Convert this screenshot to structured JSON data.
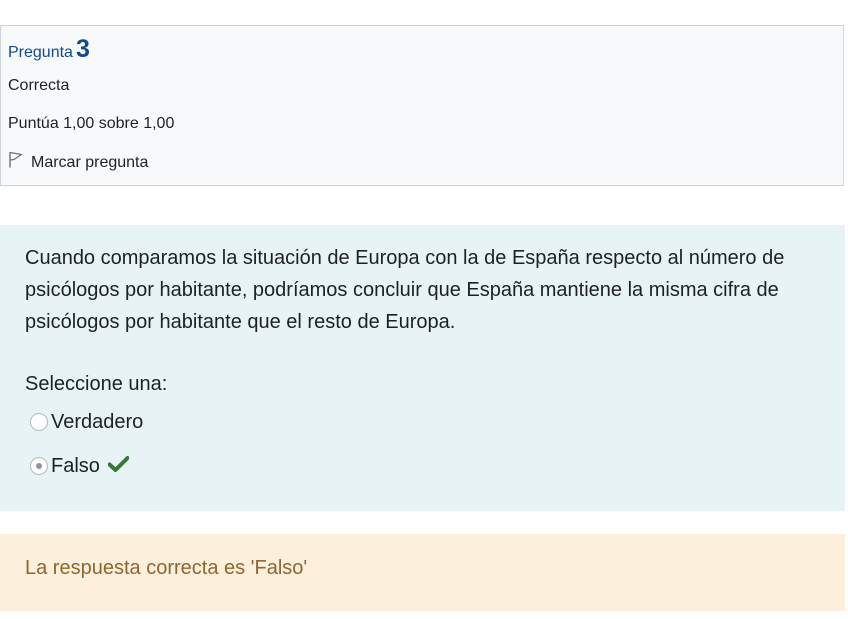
{
  "info": {
    "question_label": "Pregunta",
    "question_number": "3",
    "state": "Correcta",
    "grade": "Puntúa 1,00 sobre 1,00",
    "flag_label": "Marcar pregunta",
    "flag_icon": "flag-icon"
  },
  "question": {
    "text": "Cuando comparamos la situación de Europa con la de España respecto al número de psicólogos por habitante, podríamos concluir que España mantiene la misma cifra de psicólogos por habitante que el resto de Europa.",
    "prompt": "Seleccione una:",
    "options": [
      {
        "label": "Verdadero",
        "selected": false
      },
      {
        "label": "Falso",
        "selected": true,
        "correct_icon": "checkmark-icon"
      }
    ]
  },
  "feedback": {
    "right_answer": "La respuesta correcta es 'Falso'"
  },
  "colors": {
    "accent": "#0f4a8a",
    "correct": "#357a32",
    "formulation_bg": "#e7f3f5",
    "feedback_bg": "#fcefdc",
    "feedback_text": "#8e662e"
  }
}
